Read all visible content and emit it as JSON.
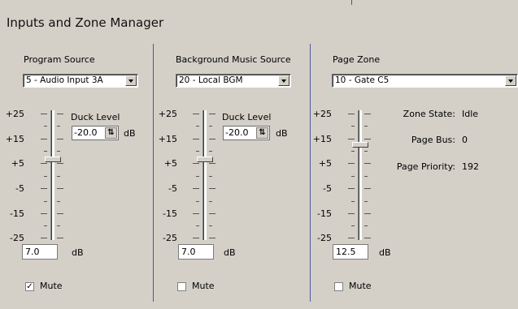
{
  "window": {
    "title": "Inputs and Zone Manager"
  },
  "scale": {
    "labels": [
      "+25",
      "+15",
      "+5",
      "-5",
      "-15",
      "-25"
    ],
    "unit": "dB"
  },
  "program": {
    "label": "Program Source",
    "selected": "5 - Audio Input 3A",
    "duck_label": "Duck Level",
    "duck_value": "-20.0",
    "duck_unit": "dB",
    "level_value": "7.0",
    "level_unit": "dB",
    "level_db": 7.0,
    "mute_label": "Mute",
    "mute_checked": true
  },
  "bgm": {
    "label": "Background Music Source",
    "selected": "20 - Local BGM",
    "duck_label": "Duck Level",
    "duck_value": "-20.0",
    "duck_unit": "dB",
    "level_value": "7.0",
    "level_unit": "dB",
    "level_db": 7.0,
    "mute_label": "Mute",
    "mute_checked": false
  },
  "page": {
    "label": "Page Zone",
    "selected": "10 - Gate C5",
    "level_value": "12.5",
    "level_unit": "dB",
    "level_db": 12.5,
    "mute_label": "Mute",
    "mute_checked": false,
    "zone_state_label": "Zone State:",
    "zone_state_value": "Idle",
    "page_bus_label": "Page Bus:",
    "page_bus_value": "0",
    "page_priority_label": "Page Priority:",
    "page_priority_value": "192"
  }
}
